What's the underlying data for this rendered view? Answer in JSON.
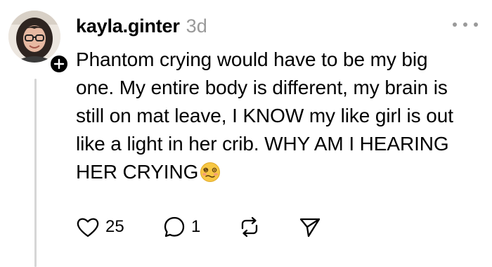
{
  "post": {
    "username": "kayla.ginter",
    "timestamp": "3d",
    "text_lines": [
      "Phantom crying would have to be my big",
      "one. My entire body is different, my brain is",
      "still on mat leave, I KNOW my like girl is out",
      "like a light in her crib. WHY AM I HEARING",
      "HER CRYING"
    ],
    "emoji": "woozy-face-emoji",
    "actions": {
      "like_count": "25",
      "reply_count": "1",
      "like_icon": "heart-icon",
      "reply_icon": "comment-bubble-icon",
      "repost_icon": "repost-icon",
      "share_icon": "send-icon"
    }
  },
  "colors": {
    "text": "#000000",
    "muted": "#9a9a9a",
    "thread_line": "#d6d6d6",
    "background": "#ffffff"
  }
}
